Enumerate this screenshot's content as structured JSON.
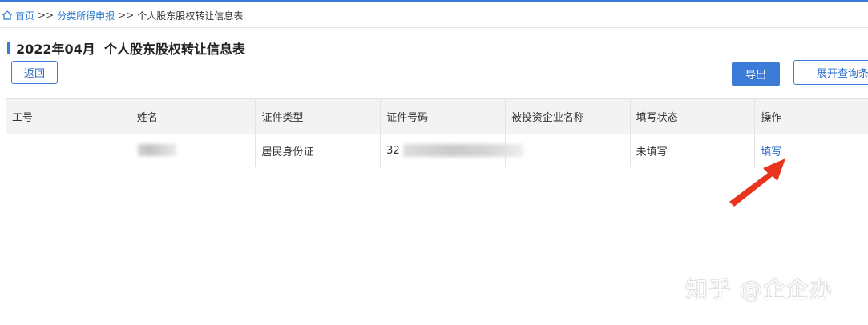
{
  "breadcrumb": {
    "home": "首页",
    "sep1": ">>",
    "category": "分类所得申报",
    "sep2": ">>",
    "current": "个人股东股权转让信息表"
  },
  "page": {
    "title": "2022年04月  个人股东股权转让信息表"
  },
  "toolbar": {
    "back_label": "返回",
    "export_label": "导出",
    "expand_label": "展开查询条"
  },
  "table": {
    "headers": [
      "工号",
      "姓名",
      "证件类型",
      "证件号码",
      "被投资企业名称",
      "填写状态",
      "操作"
    ],
    "rows": [
      {
        "id": "",
        "name": "",
        "id_type": "居民身份证",
        "id_number": "32",
        "company": "",
        "status": "未填写",
        "action": "填写"
      }
    ]
  },
  "watermark": "知乎 @企企办",
  "colors": {
    "accent": "#3d7bd9",
    "link": "#2a6cc9",
    "arrow": "#e8341c"
  }
}
